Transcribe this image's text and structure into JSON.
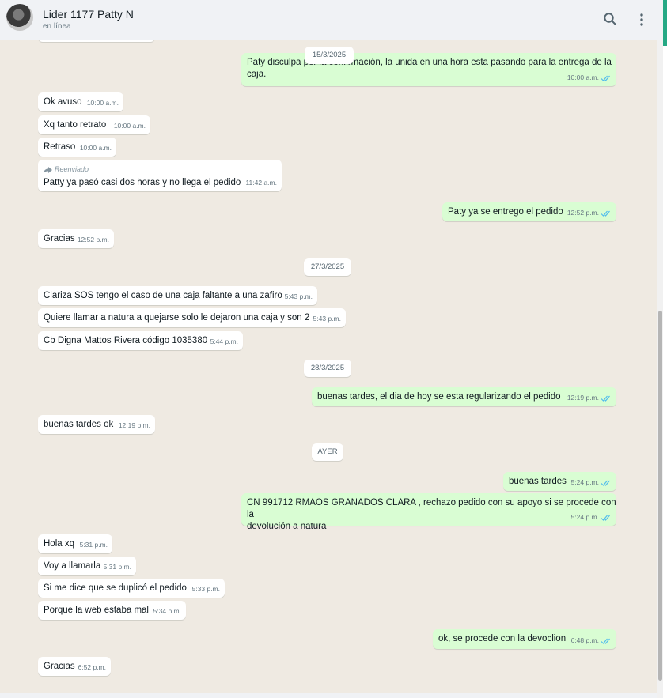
{
  "header": {
    "contact_name": "Lider 1177 Patty N",
    "status": "en línea",
    "icons": [
      "search-icon",
      "menu-icon"
    ]
  },
  "colors": {
    "outgoing_bubble": "#d9fdd3",
    "incoming_bubble": "#ffffff",
    "chat_background": "#efeae2",
    "read_ticks": "#53bdeb"
  },
  "dates": [
    "15/3/2025",
    "27/3/2025",
    "28/3/2025",
    "AYER"
  ],
  "messages": [
    {
      "dir": "out",
      "text": "Paty disculpa por la confirmación, la unida en una hora esta pasando para la entrega de la\ncaja.",
      "time": "10:00 a.m."
    },
    {
      "dir": "in",
      "text": "Ok avuso",
      "time": "10:00 a.m."
    },
    {
      "dir": "in",
      "text": "Xq tanto retrato",
      "time": "10:00 a.m."
    },
    {
      "dir": "in",
      "text": "Retraso",
      "time": "10:00 a.m."
    },
    {
      "dir": "in",
      "forward": "Reenviado",
      "text": "Patty ya pasó casi dos horas y no llega el pedido",
      "time": "11:42 a.m."
    },
    {
      "dir": "out",
      "text": "Paty ya se entrego el pedido",
      "time": "12:52 p.m."
    },
    {
      "dir": "in",
      "text": "Gracias",
      "time": "12:52 p.m."
    },
    {
      "dir": "in",
      "text": "Clariza SOS tengo el caso de una caja faltante a una zafiro",
      "time": "5:43 p.m."
    },
    {
      "dir": "in",
      "text": "Quiere llamar a natura a quejarse solo le dejaron una caja y son 2",
      "time": "5:43 p.m."
    },
    {
      "dir": "in",
      "text": "Cb Digna Mattos Rivera código 1035380",
      "time": "5:44 p.m."
    },
    {
      "dir": "out",
      "text": "buenas tardes, el dia de hoy se esta regularizando el pedido",
      "time": "12:19 p.m."
    },
    {
      "dir": "in",
      "text": "buenas tardes ok",
      "time": "12:19 p.m."
    },
    {
      "dir": "out",
      "text": "buenas tardes",
      "time": "5:24 p.m."
    },
    {
      "dir": "out",
      "text": "CN 991712 RMAOS GRANADOS CLARA , rechazo pedido con su apoyo si se procede con la\ndevolución a natura",
      "time": "5:24 p.m."
    },
    {
      "dir": "in",
      "text": "Hola xq",
      "time": "5:31 p.m."
    },
    {
      "dir": "in",
      "text": "Voy a llamarla",
      "time": "5:31 p.m."
    },
    {
      "dir": "in",
      "text": "Si me dice que se duplicó el pedido",
      "time": "5:33 p.m."
    },
    {
      "dir": "in",
      "text": "Porque la web estaba mal",
      "time": "5:34 p.m."
    },
    {
      "dir": "out",
      "text": "ok, se procede con la devoclion",
      "time": "6:48 p.m."
    },
    {
      "dir": "in",
      "text": "Gracias",
      "time": "6:52 p.m."
    }
  ]
}
